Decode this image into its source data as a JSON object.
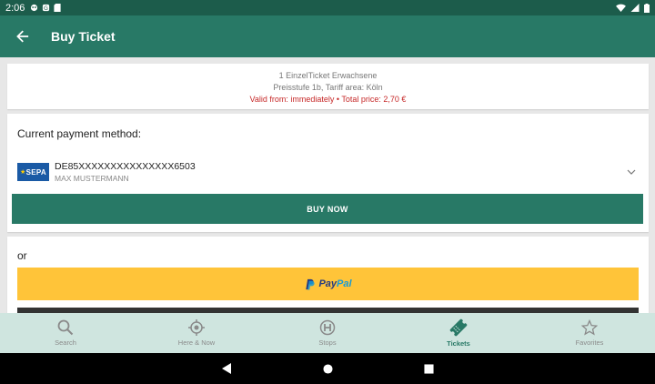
{
  "statusbar": {
    "time": "2:06"
  },
  "appbar": {
    "title": "Buy Ticket"
  },
  "summary": {
    "line1": "1 EinzelTicket Erwachsene",
    "line2": "Preisstufe 1b, Tariff area: Köln",
    "line3": "Valid from: immediately • Total price: 2,70 €"
  },
  "payment": {
    "heading": "Current payment method:",
    "logo_text": "SEPA",
    "iban": "DE85XXXXXXXXXXXXXXX6503",
    "holder": "MAX MUSTERMANN",
    "buy_label": "BUY NOW"
  },
  "alt": {
    "or_label": "or",
    "paypal_a": "Pay",
    "paypal_b": "Pal"
  },
  "nav": {
    "items": [
      {
        "label": "Search"
      },
      {
        "label": "Here & Now"
      },
      {
        "label": "Stops"
      },
      {
        "label": "Tickets"
      },
      {
        "label": "Favorites"
      }
    ]
  },
  "colors": {
    "primary": "#287966",
    "statusbar": "#1c5c4b",
    "error": "#c62828",
    "paypal": "#ffc439",
    "nav_bg": "#cfe5df"
  }
}
